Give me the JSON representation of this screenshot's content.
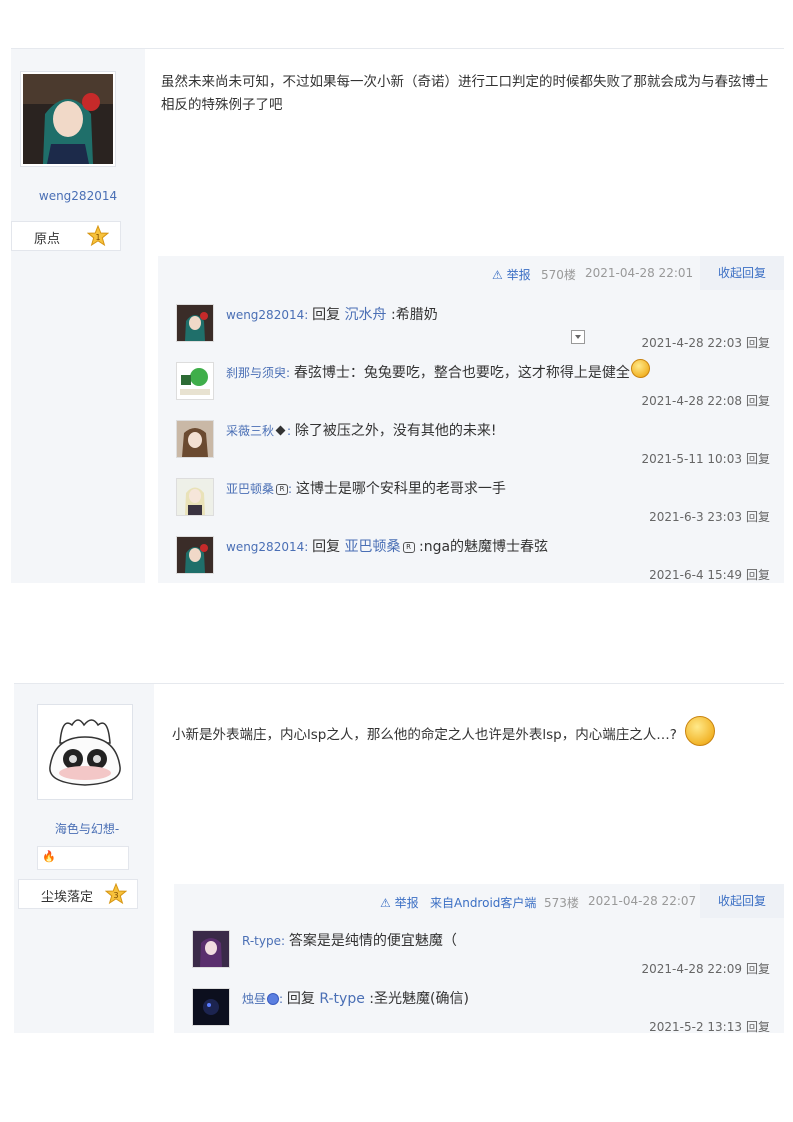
{
  "post1": {
    "username": "weng282014",
    "rank_label": "原点",
    "rank_level": "1",
    "content": "虽然未来尚未可知，不过如果每一次小新（奇诺）进行工口判定的时候都失败了那就会成为与春弦博士相反的特殊例子了吧",
    "toolbar": {
      "report": "⚠ 举报",
      "floor": "570楼",
      "time": "2021-04-28 22:01",
      "collapse": "收起回复"
    },
    "replies": [
      {
        "user": "weng282014",
        "sep": ": ",
        "prefix": "回复 ",
        "link": "沉水舟",
        "text": " :希腊奶",
        "time": "2021-4-28 22:03",
        "reply": "回复"
      },
      {
        "user": "刹那与须臾",
        "sep": ": ",
        "text": "春弦博士：兔兔要吃，整合也要吃，这才称得上是健全",
        "time": "2021-4-28 22:08",
        "reply": "回复"
      },
      {
        "user": "采薇三秋",
        "sep": ": ",
        "text": "除了被压之外，没有其他的未来!",
        "time": "2021-5-11 10:03",
        "reply": "回复"
      },
      {
        "user": "亚巴顿桑",
        "sep": ": ",
        "text": "这博士是哪个安科里的老哥求一手",
        "time": "2021-6-3 23:03",
        "reply": "回复"
      },
      {
        "user": "weng282014",
        "sep": ": ",
        "prefix": "回复 ",
        "link": "亚巴顿桑",
        "text": " :nga的魅魔博士春弦",
        "time": "2021-6-4 15:49",
        "reply": "回复"
      }
    ]
  },
  "post2": {
    "username": "海色与幻想-",
    "rank_label": "尘埃落定",
    "rank_level": "3",
    "content": "小新是外表端庄，内心lsp之人，那么他的命定之人也许是外表lsp，内心端庄之人…?",
    "toolbar": {
      "report": "⚠ 举报",
      "client": "来自Android客户端",
      "floor": "573楼",
      "time": "2021-04-28 22:07",
      "collapse": "收起回复"
    },
    "replies": [
      {
        "user": "R-type",
        "sep": ": ",
        "text": "答案是是纯情的便宜魅魔（",
        "time": "2021-4-28 22:09",
        "reply": "回复"
      },
      {
        "user": "烛昼",
        "sep": ": ",
        "prefix": "回复 ",
        "link": "R-type",
        "text": " :圣光魅魔(确信)",
        "time": "2021-5-2 13:13",
        "reply": "回复"
      }
    ]
  },
  "colors": {
    "link": "#4a6fb5",
    "accent": "#3b6fc4",
    "panel": "#f4f6f9"
  }
}
